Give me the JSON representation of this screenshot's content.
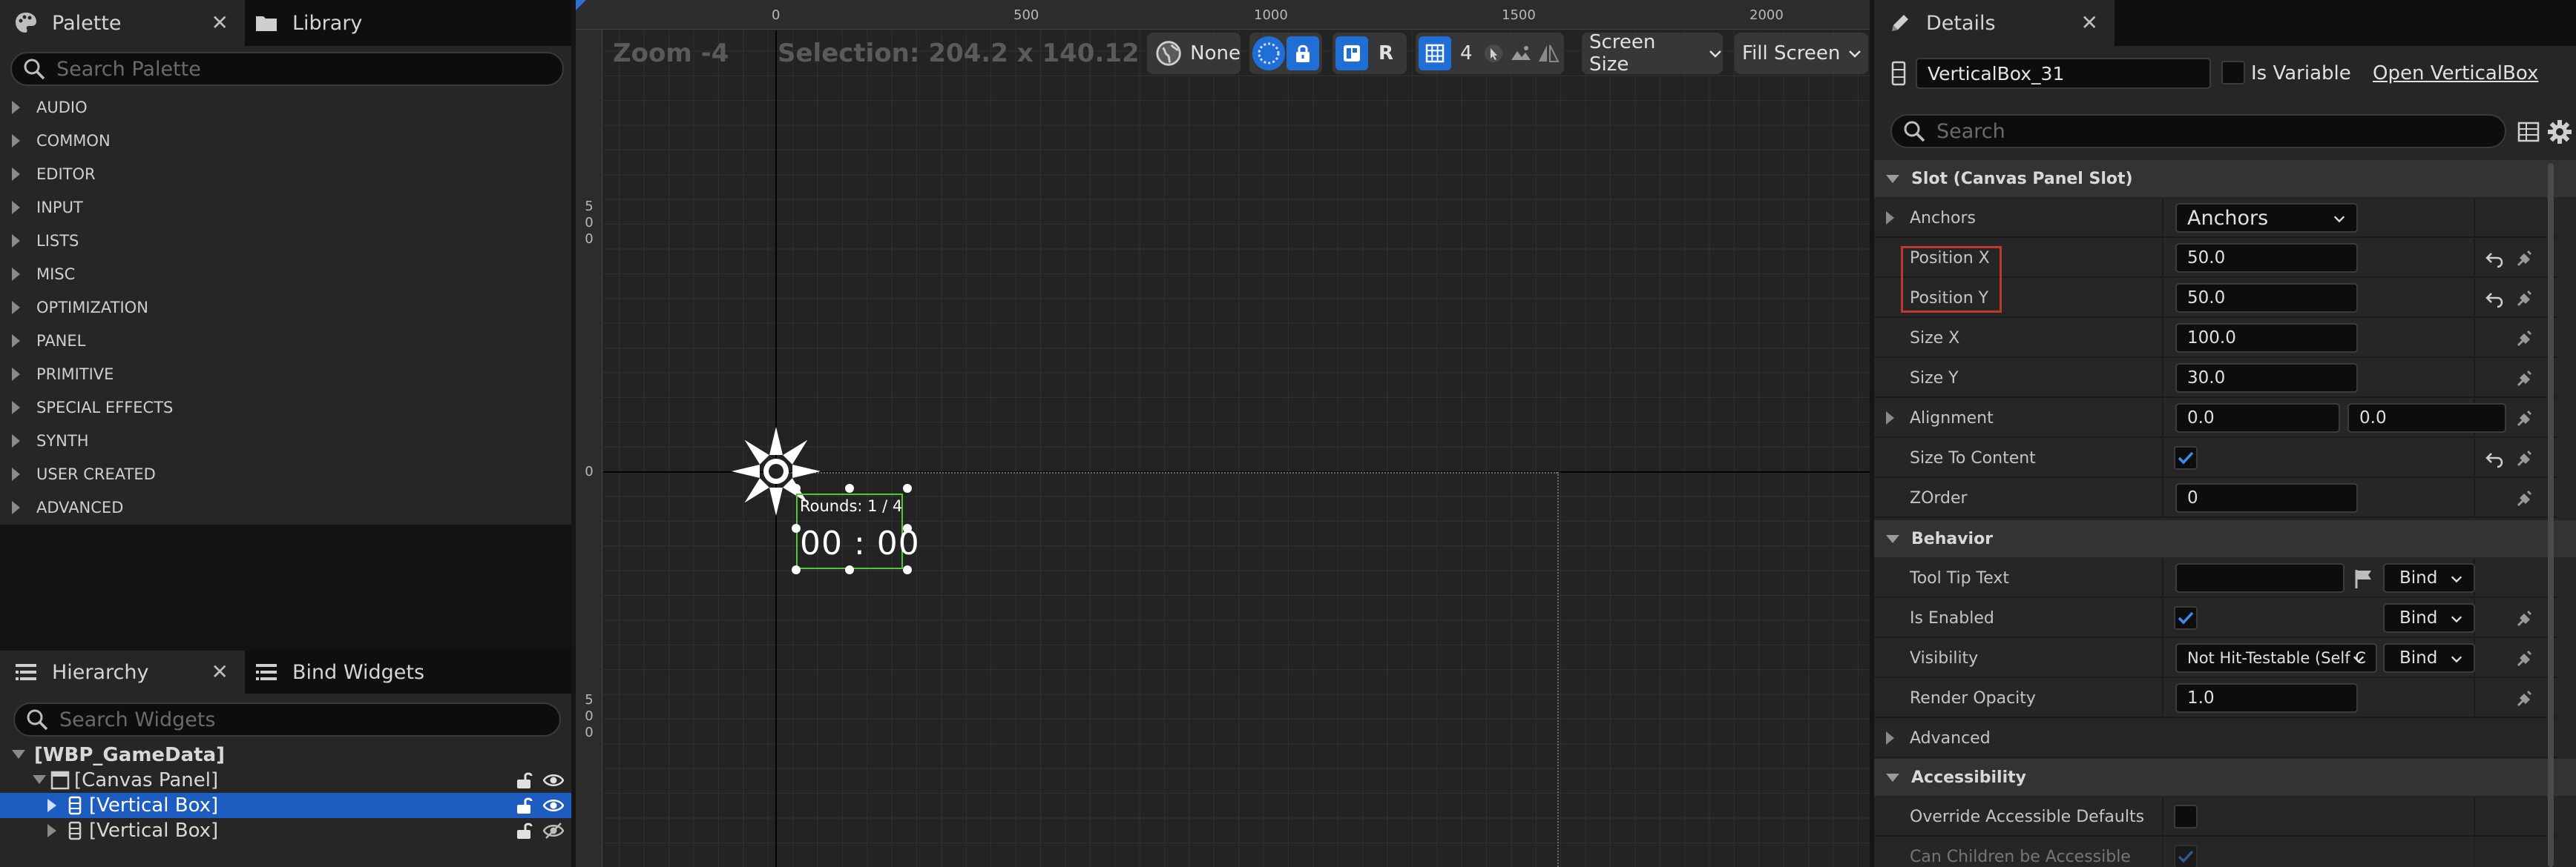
{
  "palette_panel": {
    "tab_label": "Palette",
    "close_glyph": "✕",
    "library_tab_label": "Library",
    "search_placeholder": "Search Palette",
    "categories": [
      "AUDIO",
      "COMMON",
      "EDITOR",
      "INPUT",
      "LISTS",
      "MISC",
      "OPTIMIZATION",
      "PANEL",
      "PRIMITIVE",
      "SPECIAL EFFECTS",
      "SYNTH",
      "USER CREATED",
      "ADVANCED"
    ]
  },
  "hierarchy_panel": {
    "tab_label": "Hierarchy",
    "close_glyph": "✕",
    "bind_widgets_tab_label": "Bind Widgets",
    "search_placeholder": "Search Widgets",
    "tree": [
      {
        "label": "[WBP_GameData]",
        "depth": 0,
        "selected": false
      },
      {
        "label": "[Canvas Panel]",
        "depth": 1,
        "selected": false
      },
      {
        "label": "[Vertical Box]",
        "depth": 2,
        "selected": true
      },
      {
        "label": "[Vertical Box]",
        "depth": 2,
        "selected": false
      }
    ]
  },
  "viewport": {
    "zoom_text": "Zoom -4",
    "selection_text": "Selection: 204.2 x 140.12",
    "toolbar": {
      "localization_label": "None",
      "respect_locks_label": "R",
      "grid_snap_value": "4",
      "screen_size_label": "Screen Size",
      "fill_screen_label": "Fill Screen"
    },
    "ruler_top_labels": [
      "0",
      "500",
      "1000",
      "1500",
      "2000"
    ],
    "ruler_left_labels": [
      "500",
      "0",
      "500"
    ],
    "widget": {
      "rounds_text": "Rounds: 1 / 4",
      "timer_text": "00 : 00"
    }
  },
  "details_panel": {
    "tab_label": "Details",
    "close_glyph": "✕",
    "widget_name": "VerticalBox_31",
    "is_variable_label": "Is Variable",
    "open_link_label": "Open VerticalBox",
    "search_placeholder": "Search",
    "sections": {
      "slot": "Slot (Canvas Panel Slot)",
      "behavior": "Behavior",
      "accessibility": "Accessibility"
    },
    "slot_props": {
      "anchors_label": "Anchors",
      "anchors_value": "Anchors",
      "position_x_label": "Position X",
      "position_x_value": "50.0",
      "position_y_label": "Position Y",
      "position_y_value": "50.0",
      "size_x_label": "Size X",
      "size_x_value": "100.0",
      "size_y_label": "Size Y",
      "size_y_value": "30.0",
      "alignment_label": "Alignment",
      "alignment_x": "0.0",
      "alignment_y": "0.0",
      "size_to_content_label": "Size To Content",
      "zorder_label": "ZOrder",
      "zorder_value": "0"
    },
    "behavior_props": {
      "tooltip_label": "Tool Tip Text",
      "tooltip_value": "",
      "bind_label": "Bind",
      "is_enabled_label": "Is Enabled",
      "visibility_label": "Visibility",
      "visibility_value": "Not Hit-Testable (Self C",
      "render_opacity_label": "Render Opacity",
      "render_opacity_value": "1.0",
      "advanced_label": "Advanced"
    },
    "accessibility_props": {
      "override_label": "Override Accessible Defaults",
      "can_children_label": "Can Children be Accessible"
    },
    "highlight_color": "#c0392b",
    "accent_color": "#1f6fd6"
  }
}
